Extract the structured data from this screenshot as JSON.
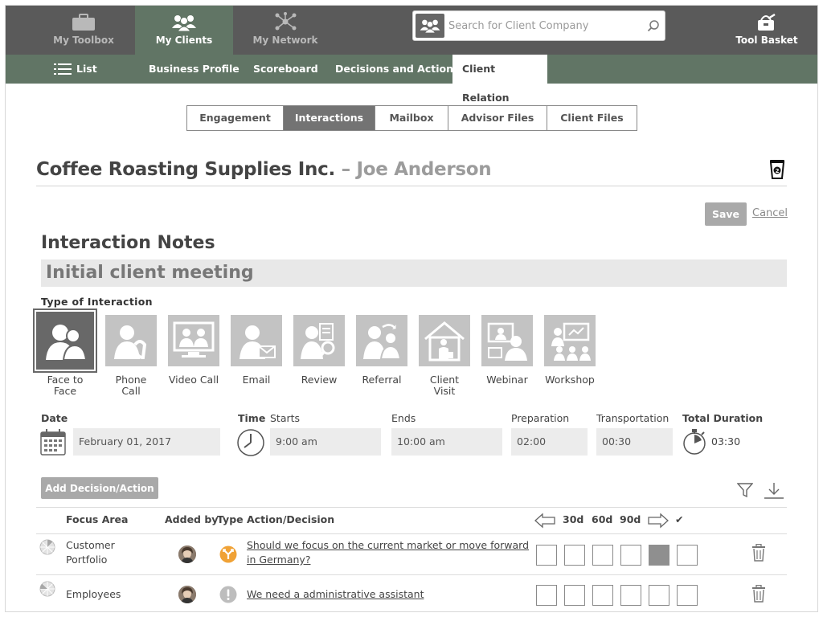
{
  "topnav": {
    "toolbox": "My Toolbox",
    "clients": "My Clients",
    "network": "My Network",
    "search_placeholder": "Search for Client Company",
    "toolbasket": "Tool Basket"
  },
  "subnav": {
    "list": "List",
    "business_profile": "Business Profile",
    "scoreboard": "Scoreboard",
    "decisions": "Decisions and Actions",
    "client_relation": "Client Relation"
  },
  "tabs": [
    "Engagement",
    "Interactions",
    "Mailbox",
    "Advisor Files",
    "Client Files"
  ],
  "header": {
    "company": "Coffee Roasting Supplies Inc.",
    "separator": "–",
    "person": "Joe Anderson"
  },
  "actions": {
    "save": "Save",
    "cancel": "Cancel"
  },
  "notes": {
    "title": "Interaction Notes",
    "value": "Initial client meeting"
  },
  "interaction_types": {
    "label": "Type of Interaction",
    "items": [
      {
        "line1": "Face to",
        "line2": "Face"
      },
      {
        "line1": "Phone",
        "line2": "Call"
      },
      {
        "line1": "Video Call",
        "line2": ""
      },
      {
        "line1": "Email",
        "line2": ""
      },
      {
        "line1": "Review",
        "line2": ""
      },
      {
        "line1": "Referral",
        "line2": ""
      },
      {
        "line1": "Client",
        "line2": "Visit"
      },
      {
        "line1": "Webinar",
        "line2": ""
      },
      {
        "line1": "Workshop",
        "line2": ""
      }
    ]
  },
  "schedule": {
    "date_label": "Date",
    "date": "February 01, 2017",
    "time_label": "Time",
    "starts_label": "Starts",
    "starts": "9:00 am",
    "ends_label": "Ends",
    "ends": "10:00 am",
    "prep_label": "Preparation",
    "prep": "02:00",
    "transport_label": "Transportation",
    "transport": "00:30",
    "total_label": "Total Duration",
    "total": "03:30"
  },
  "decisions": {
    "add_button": "Add Decision/Action",
    "headers": {
      "focus": "Focus Area",
      "added_by": "Added by",
      "type": "Type",
      "action": "Action/Decision",
      "d30": "30d",
      "d60": "60d",
      "d90": "90d",
      "check": "✔"
    },
    "rows": [
      {
        "focus_line1": "Customer",
        "focus_line2": "Portfolio",
        "action_line1": "Should we focus on the current market or move forward",
        "action_line2": "in Germany?",
        "filled_box": 4
      },
      {
        "focus_line1": "Employees",
        "focus_line2": "",
        "action_line1": "We need a administrative assistant",
        "action_line2": "",
        "filled_box": -1
      }
    ]
  }
}
